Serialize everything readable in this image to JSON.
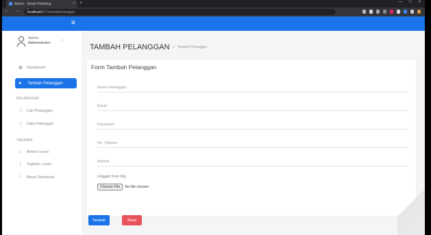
{
  "browser": {
    "tab_title": "Admin - Smart Polishing",
    "tab_close": "×",
    "new_tab": "+",
    "window_buttons": [
      "—",
      "□",
      "×"
    ],
    "nav_glyphs": "← → C",
    "url_host": "localhost",
    "url_path": "/BC/tambahpelanggan"
  },
  "topbar": {
    "menu_glyph": "≡"
  },
  "sidebar": {
    "user_name": "Admin",
    "user_role": "Administrator",
    "user_caret": "⌄",
    "dashboard": "Dashboard",
    "active_item": "Tambah Pelanggan",
    "section_pelanggan": "PELANGGAN",
    "cari_pelanggan": "Cari Pelanggan",
    "data_pelanggan": "Data Pelanggan",
    "section_tagihan": "TAGIHAN",
    "belum_lunas": "Belum Lunas",
    "tagihan_lunas": "Tagihan Lunas",
    "biaya_tambahan": "Biaya Tambahan"
  },
  "main": {
    "page_title": "TAMBAH PELANGGAN",
    "breadcrumb_sep": ">",
    "breadcrumb_current": "Tambah Pelanggan",
    "form_title": "Form Tambah Pelanggan",
    "fields": {
      "nama": "Nama Pelanggan",
      "email": "Email",
      "password": "Password",
      "telepon": "No. Telepon",
      "alamat": "Alamat"
    },
    "upload_label": "Unggah Foto Ktp",
    "file_button": "Choose File",
    "file_status": "No file chosen",
    "btn_add": "Tambah",
    "btn_cancel": "Batal"
  },
  "colors": {
    "primary": "#1a73e8",
    "danger": "#e8525b",
    "background": "#f4f5f7"
  }
}
